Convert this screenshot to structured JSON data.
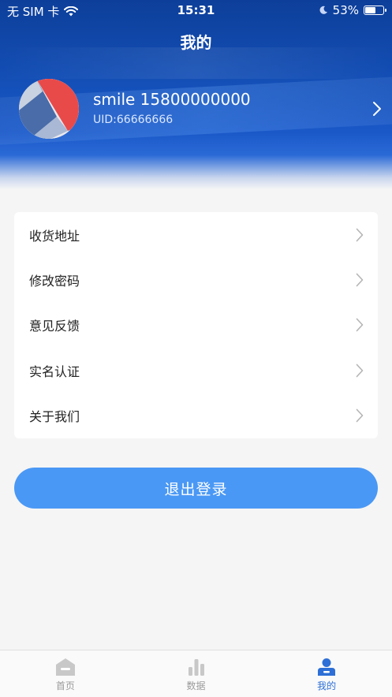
{
  "status_bar": {
    "carrier": "无 SIM 卡",
    "time": "15:31",
    "battery": "53%",
    "battery_level": 0.53
  },
  "header": {
    "title": "我的"
  },
  "profile": {
    "name": "smile 15800000000",
    "uid": "UID:66666666"
  },
  "menu": {
    "items": [
      {
        "label": "收货地址"
      },
      {
        "label": "修改密码"
      },
      {
        "label": "意见反馈"
      },
      {
        "label": "实名认证"
      },
      {
        "label": "关于我们"
      }
    ]
  },
  "logout_label": "退出登录",
  "tabs": [
    {
      "label": "首页",
      "icon": "home-icon",
      "active": false
    },
    {
      "label": "数据",
      "icon": "chart-icon",
      "active": false
    },
    {
      "label": "我的",
      "icon": "user-icon",
      "active": true
    }
  ],
  "colors": {
    "primary": "#4a98f5",
    "header_blue": "#1450b8",
    "tab_active": "#2d6fd6",
    "tab_inactive": "#c8c8c8"
  }
}
